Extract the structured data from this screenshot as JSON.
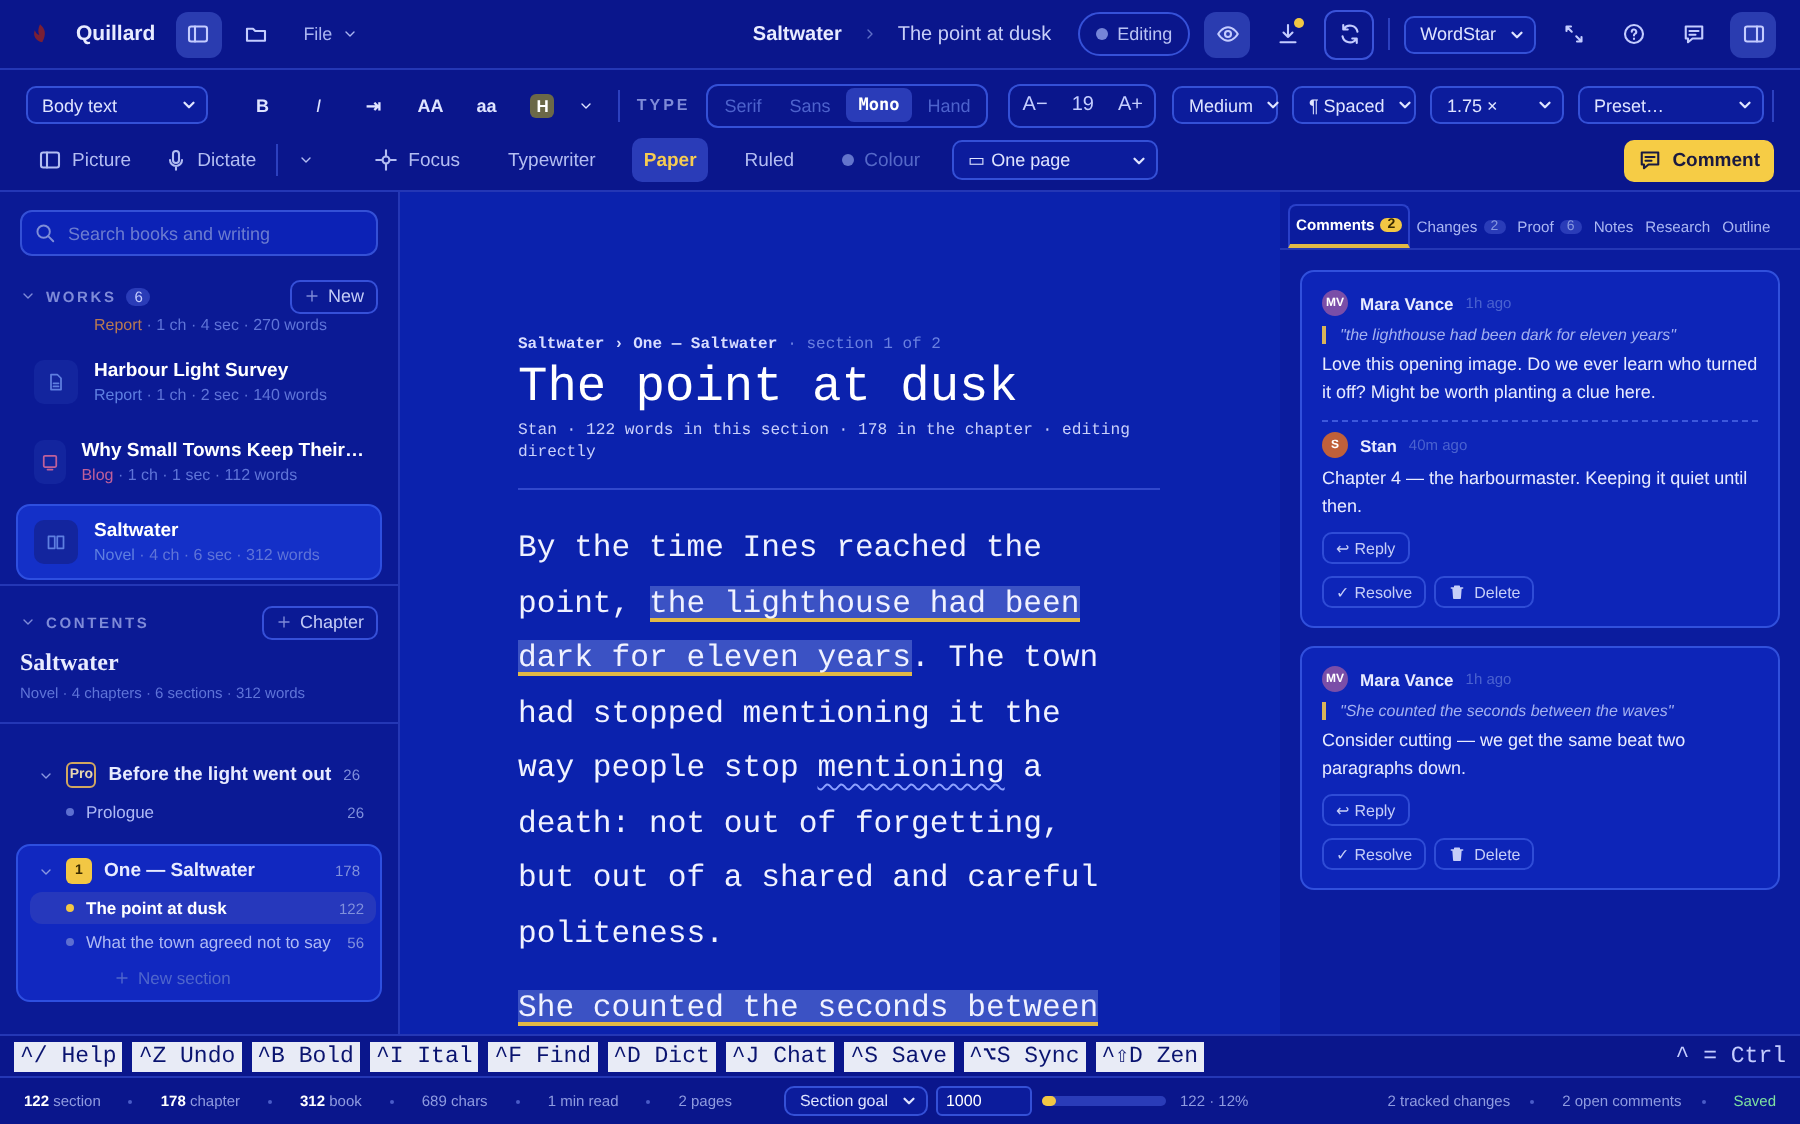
{
  "top_bar": {
    "app_name": "Quillard",
    "sidebar_toggle": {
      "on": true
    },
    "file_menu": "File",
    "breadcrumb": [
      "Saltwater",
      "The point at dusk"
    ],
    "mode": "Editing",
    "preview_toggle": {
      "on": true
    },
    "export": {
      "pending": true
    },
    "keymap": "WordStar",
    "panel_toggle": {
      "on": true
    }
  },
  "format_bar": {
    "paragraph_style": "Body text",
    "buttons": [
      {
        "label": "B",
        "kind": "bold"
      },
      {
        "label": "I",
        "kind": "italic"
      },
      {
        "label": "⇥",
        "kind": "plain"
      },
      {
        "label": "AA",
        "kind": "plain"
      },
      {
        "label": "aa",
        "kind": "plain"
      }
    ],
    "highlight": "H",
    "type_label": "TYPE",
    "typefaces": [
      {
        "label": "Serif",
        "selected": false
      },
      {
        "label": "Sans",
        "selected": false
      },
      {
        "label": "Mono",
        "selected": true
      },
      {
        "label": "Hand",
        "selected": false
      }
    ],
    "size": {
      "decrease": "A−",
      "value": "19",
      "increase": "A+"
    },
    "weight": "Medium",
    "spacing": "¶ Spaced",
    "line_height": "1.75 ×",
    "preset": "Preset…"
  },
  "view_bar": {
    "picture": "Picture",
    "dictate": "Dictate",
    "modes": [
      {
        "label": "Focus",
        "kind": "focus",
        "on": false
      },
      {
        "label": "Typewriter",
        "kind": "plain",
        "on": false
      },
      {
        "label": "Paper",
        "kind": "plain",
        "on": true
      },
      {
        "label": "Ruled",
        "kind": "plain",
        "on": false
      }
    ],
    "colour": {
      "label": "Colour",
      "disabled": true
    },
    "layout": "▭ One page",
    "comment_button": "Comment"
  },
  "sidebar": {
    "search": {
      "placeholder": "Search books and writing"
    },
    "works": {
      "title": "WORKS",
      "count": "6",
      "new_button": "New",
      "items": [
        {
          "type": "Report",
          "meta": " · 1 ch · 4 sec · 270 words",
          "color": "#b97a52",
          "selected": false
        },
        {
          "kind": "report",
          "title": "Harbour Light Survey",
          "type": "Report",
          "meta": " · 1 ch · 2 sec · 140 words",
          "color": "#5f7fe0",
          "selected": false
        },
        {
          "kind": "blog",
          "title": "Why Small Towns Keep Their…",
          "type": "Blog",
          "meta": " · 1 ch · 1 sec · 112 words",
          "color": "#c0609a",
          "selected": false
        },
        {
          "kind": "novel",
          "title": "Saltwater",
          "type": "Novel",
          "meta": " · 4 ch · 6 sec · 312 words",
          "color": "#5f7fe0",
          "selected": true
        }
      ]
    },
    "contents": {
      "title": "CONTENTS",
      "add_button": "Chapter",
      "book_title": "Saltwater",
      "book_meta": "Novel · 4 chapters · 6 sections · 312 words",
      "chapters": [
        {
          "badge": "Pro",
          "kind": "outline",
          "title": "Before the light went out",
          "count": "26",
          "expanded": true,
          "selected": false,
          "children": [
            {
              "title": "Prologue",
              "count": "26",
              "selected": false
            }
          ]
        },
        {
          "badge": "1",
          "kind": "filled",
          "title": "One — Saltwater",
          "count": "178",
          "expanded": true,
          "selected": true,
          "children": [
            {
              "title": "The point at dusk",
              "count": "122",
              "selected": true
            },
            {
              "title": "What the town agreed not to say",
              "count": "56",
              "selected": false
            }
          ],
          "new_section": "New section"
        }
      ]
    }
  },
  "editor": {
    "breadcrumb": "Saltwater › One — Saltwater",
    "section": "· section 1 of 2",
    "title": "The point at dusk",
    "meta": "Stan · 122 words in this section · 178 in the chapter · editing directly",
    "paragraphs": [
      [
        {
          "kind": "plain",
          "text": "By the time Ines reached the point, "
        },
        {
          "kind": "comment",
          "text": "the lighthouse had been dark for eleven years"
        },
        {
          "kind": "plain",
          "text": ". The town had stopped mentioning it the way people stop "
        },
        {
          "kind": "spelling",
          "text": "mentioning"
        },
        {
          "kind": "plain",
          "text": " a death: not out of forgetting, but out of a shared and careful politeness."
        }
      ],
      [
        {
          "kind": "comment",
          "text": "She counted the seconds between"
        }
      ]
    ]
  },
  "panel": {
    "tabs": [
      {
        "label": "Comments",
        "count": "2",
        "selected": true
      },
      {
        "label": "Changes",
        "count": "2",
        "selected": false
      },
      {
        "label": "Proof",
        "count": "6",
        "selected": false
      },
      {
        "label": "Notes",
        "selected": false
      },
      {
        "label": "Research",
        "selected": false
      },
      {
        "label": "Outline",
        "selected": false
      }
    ],
    "threads": [
      {
        "comments": [
          {
            "initials": "MV",
            "author": "Mara Vance",
            "time": "1h ago",
            "color": "#7a4ea8",
            "quote": "\"the lighthouse had been dark for eleven years\"",
            "body": "Love this opening image. Do we ever learn who turned it off? Might be worth planting a clue here."
          },
          {
            "initials": "S",
            "author": "Stan",
            "time": "40m ago",
            "color": "#c0603a",
            "body": "Chapter 4 — the harbourmaster. Keeping it quiet until then."
          }
        ],
        "reply": "↩ Reply",
        "resolve": "✓ Resolve",
        "delete": "Delete"
      },
      {
        "comments": [
          {
            "initials": "MV",
            "author": "Mara Vance",
            "time": "1h ago",
            "color": "#7a4ea8",
            "quote": "\"She counted the seconds between the waves\"",
            "body": "Consider cutting — we get the same beat two paragraphs down."
          }
        ],
        "reply": "↩ Reply",
        "resolve": "✓ Resolve",
        "delete": "Delete"
      }
    ]
  },
  "keys_bar": {
    "keys": [
      "^/ Help",
      "^Z Undo",
      "^B Bold",
      "^I Ital",
      "^F Find",
      "^D Dict",
      "^J Chat",
      "^S Save",
      "^⌥S Sync",
      "^⇧D Zen"
    ],
    "legend": "^ = Ctrl"
  },
  "status_bar": {
    "counts": [
      {
        "value": "122",
        "label": "section"
      },
      {
        "value": "178",
        "label": "chapter"
      },
      {
        "value": "312",
        "label": "book"
      },
      {
        "text": "689 chars"
      },
      {
        "text": "1 min read"
      },
      {
        "text": "2 pages"
      }
    ],
    "goal_select": "Section goal",
    "goal_value": "1000",
    "goal": {
      "level": 0.12,
      "reading": "122 · 12%"
    },
    "right": [
      "2 tracked changes",
      "2 open comments"
    ],
    "saved": "Saved"
  }
}
